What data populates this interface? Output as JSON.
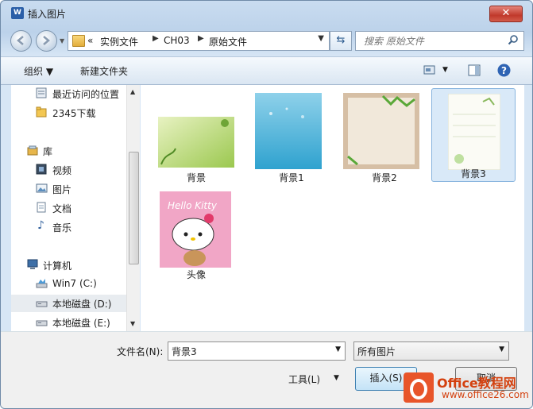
{
  "window": {
    "title": "插入图片",
    "app_icon": "W",
    "close_glyph": "✕"
  },
  "address": {
    "crumbs": [
      "实例文件",
      "CH03",
      "原始文件"
    ],
    "prefix": "«"
  },
  "search": {
    "placeholder": "搜索 原始文件"
  },
  "toolbar": {
    "organize": "组织 ▼",
    "new_folder": "新建文件夹"
  },
  "sidebar": {
    "items": [
      {
        "label": "最近访问的位置",
        "icon": "recent-places-icon"
      },
      {
        "label": "2345下载",
        "icon": "folder-icon"
      },
      {
        "label": "库",
        "icon": "library-icon"
      },
      {
        "label": "视频",
        "icon": "video-icon"
      },
      {
        "label": "图片",
        "icon": "picture-icon"
      },
      {
        "label": "文档",
        "icon": "document-icon"
      },
      {
        "label": "音乐",
        "icon": "music-icon"
      },
      {
        "label": "计算机",
        "icon": "computer-icon"
      },
      {
        "label": "Win7 (C:)",
        "icon": "drive-icon"
      },
      {
        "label": "本地磁盘 (D:)",
        "icon": "drive-icon"
      },
      {
        "label": "本地磁盘 (E:)",
        "icon": "drive-icon"
      }
    ]
  },
  "files": [
    {
      "name": "背景",
      "selected": false
    },
    {
      "name": "背景1",
      "selected": false
    },
    {
      "name": "背景2",
      "selected": false
    },
    {
      "name": "背景3",
      "selected": true
    },
    {
      "name": "头像",
      "selected": false
    }
  ],
  "hello_kitty_text": "Hello Kitty",
  "bottom": {
    "filename_label": "文件名(N):",
    "filename_value": "背景3",
    "filter_value": "所有图片",
    "tools_label": "工具(L)",
    "insert_label": "插入(S)",
    "cancel_label": "取消"
  },
  "watermark": {
    "brand": "Office教程网",
    "url": "www.office26.com"
  },
  "colors": {
    "accent": "#3c7fb1",
    "selection": "#d9e9f8"
  }
}
